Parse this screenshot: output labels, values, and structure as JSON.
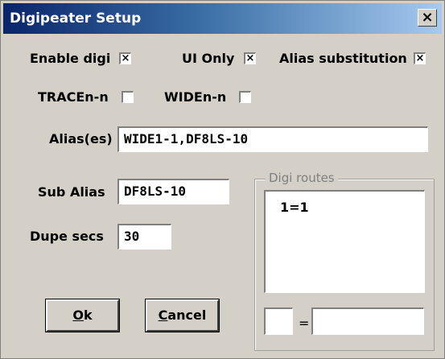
{
  "window": {
    "title": "Digipeater Setup",
    "close_glyph": "×"
  },
  "options": {
    "enable_digi": {
      "label": "Enable digi",
      "checked": true,
      "mark": "×"
    },
    "ui_only": {
      "label": "UI Only",
      "checked": true,
      "mark": "×"
    },
    "alias_substitution": {
      "label": "Alias substitution",
      "checked": true,
      "mark": "×"
    },
    "tracen_n": {
      "label": "TRACEn-n",
      "checked": false,
      "mark": ""
    },
    "widen_n": {
      "label": "WIDEn-n",
      "checked": false,
      "mark": ""
    }
  },
  "fields": {
    "aliases": {
      "label": "Alias(es)",
      "value": "WIDE1-1,DF8LS-10"
    },
    "sub_alias": {
      "label": "Sub Alias",
      "value": "DF8LS-10"
    },
    "dupe_secs": {
      "label": "Dupe secs",
      "value": "30"
    }
  },
  "digi_routes": {
    "label": "Digi routes",
    "items": [
      "1=1"
    ],
    "editor": {
      "left": "",
      "equals": "=",
      "right": ""
    }
  },
  "buttons": {
    "ok": "Ok",
    "cancel": "Cancel"
  }
}
